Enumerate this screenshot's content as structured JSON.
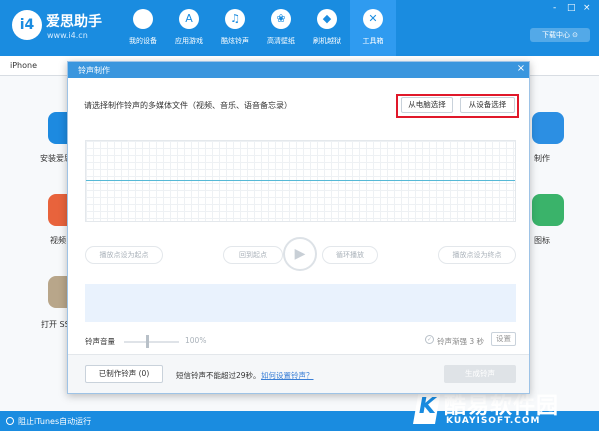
{
  "app": {
    "name": "爱思助手",
    "url": "www.i4.cn",
    "logo_text": "i4"
  },
  "nav": [
    {
      "label": "我的设备",
      "icon": ""
    },
    {
      "label": "应用游戏",
      "icon": "A"
    },
    {
      "label": "酷炫铃声",
      "icon": "♫"
    },
    {
      "label": "高清壁纸",
      "icon": "❀"
    },
    {
      "label": "刷机越狱",
      "icon": "◆"
    },
    {
      "label": "工具箱",
      "icon": "✕"
    }
  ],
  "window_controls": [
    "-",
    "□",
    "×"
  ],
  "download_center": "下载中心 ⊙",
  "device_tab": "iPhone",
  "background_labels": [
    "安装爱思",
    "视频",
    "打开 SS",
    "制作",
    "图标"
  ],
  "status_bar": {
    "text": "阻止iTunes自动运行"
  },
  "watermark": {
    "main": "酷易软件园",
    "sub": "KUAYISOFT.COM",
    "letter": "K"
  },
  "dialog": {
    "title": "铃声制作",
    "close": "×",
    "hint": "请选择制作铃声的多媒体文件（视频、音乐、语音备忘录）",
    "from_pc": "从电脑选择",
    "from_device": "从设备选择",
    "set_start": "播放点设为起点",
    "back_to_start": "回到起点",
    "loop": "循环播放",
    "set_end": "播放点设为终点",
    "volume_label": "铃声音量",
    "volume_value": "100%",
    "fade_label": "铃声渐强 3 秒",
    "settings": "设置",
    "made_ringtones": "已制作铃声 (0)",
    "limit_note": "短信铃声不能超过29秒。",
    "how_to": "如何设置铃声？",
    "generate": "生成铃声"
  },
  "colors": {
    "brand": "#1a8ce0",
    "highlight_box": "#e0182a"
  }
}
